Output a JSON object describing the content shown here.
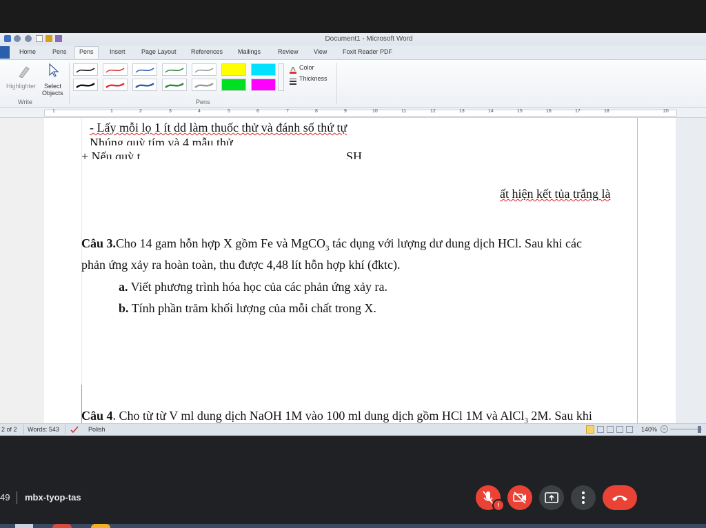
{
  "window": {
    "title": "Document1 - Microsoft Word"
  },
  "tabs": [
    {
      "label": "Home"
    },
    {
      "label": "Pens"
    },
    {
      "label": "Pens"
    },
    {
      "label": "Insert"
    },
    {
      "label": "Page Layout"
    },
    {
      "label": "References"
    },
    {
      "label": "Mailings"
    },
    {
      "label": "Review"
    },
    {
      "label": "View"
    },
    {
      "label": "Foxit Reader PDF"
    }
  ],
  "ribbon": {
    "highlighter_label": "Highlighter",
    "select_objects_line1": "Select",
    "select_objects_line2": "Objects",
    "group_write": "Write",
    "group_pens": "Pens",
    "color_label": "Color",
    "thickness_label": "Thickness"
  },
  "ruler": {
    "numbers": [
      "1",
      "1",
      "2",
      "3",
      "4",
      "5",
      "6",
      "7",
      "8",
      "9",
      "10",
      "11",
      "12",
      "13",
      "14",
      "15",
      "16",
      "17",
      "18",
      "20"
    ]
  },
  "doc": {
    "line1": "- Lấy mỗi lọ 1 ít dd làm thuốc thử và đánh số thứ tự",
    "line2": "Nhúng quỳ tím và 4 mẫu thử",
    "line3_a": "+ Nếu quỳ t",
    "line3_b": "SH",
    "line4": "ất hiện kết tủa trắng là",
    "q3_label": "Câu 3.",
    "q3_text_a": "Cho 14 gam hỗn hợp X gồm Fe và MgCO",
    "q3_sub": "3",
    "q3_text_b": " tác dụng với lượng dư dung dịch HCl. Sau khi các",
    "q3_line2": "phản ứng xảy ra hoàn toàn, thu được 4,48 lít hỗn hợp khí (đktc).",
    "q3a_label": "a.",
    "q3a_text": " Viết phương trình hóa học của các phản ứng xảy ra.",
    "q3b_label": "b.",
    "q3b_text": " Tính phần trăm khối lượng của mỗi chất trong X.",
    "q4_label": "Câu 4",
    "q4_text_a": ". Cho từ từ V ml dung dịch NaOH 1M vào 100 ml dung dịch gồm HCl 1M và AlCl",
    "q4_sub": "3",
    "q4_text_b": " 2M. Sau khi"
  },
  "status": {
    "page": "2 of 2",
    "words": "Words: 543",
    "language": "Polish",
    "zoom": "140%"
  },
  "meet": {
    "time": "49",
    "code": "mbx-tyop-tas"
  },
  "colors": {
    "end_call": "#ea4335",
    "mic_off": "#ea4335"
  }
}
